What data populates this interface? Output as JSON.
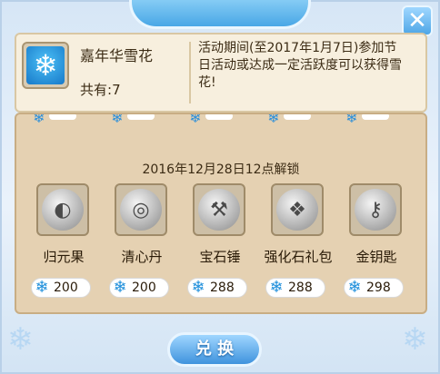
{
  "close_icon": "close-icon",
  "info": {
    "item_name": "嘉年华雪花",
    "count_label": "共有:",
    "count_value": "7",
    "description": "活动期间(至2017年1月7日)参加节日活动或达成一定活跃度可以获得雪花!"
  },
  "unlock_text": "2016年12月28日12点解锁",
  "items": [
    {
      "name": "归元果",
      "price": "200",
      "icon": "fruit-icon"
    },
    {
      "name": "清心丹",
      "price": "200",
      "icon": "pill-icon"
    },
    {
      "name": "宝石锤",
      "price": "288",
      "icon": "hammer-icon"
    },
    {
      "name": "强化石礼包",
      "price": "288",
      "icon": "giftbag-icon"
    },
    {
      "name": "金钥匙",
      "price": "298",
      "icon": "key-icon"
    }
  ],
  "exchange_button": "兑 换"
}
